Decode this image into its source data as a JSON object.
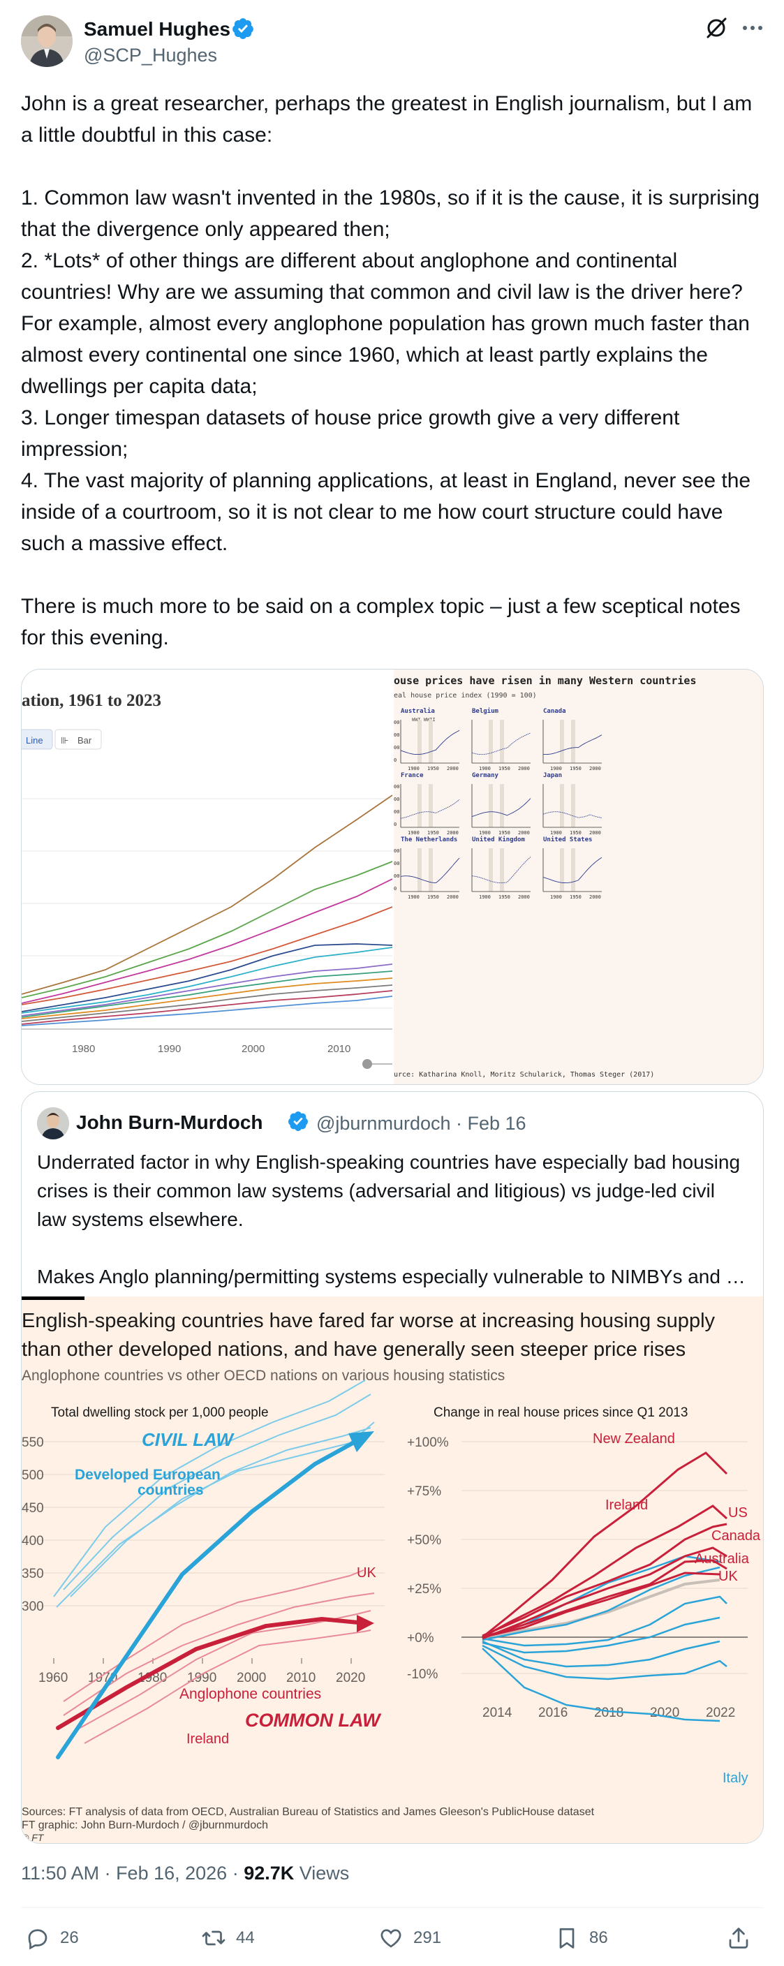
{
  "author": {
    "name": "Samuel Hughes",
    "handle": "@SCP_Hughes"
  },
  "tweet": {
    "paragraphs": [
      "John is a great researcher, perhaps the greatest in English journalism, but I am a little doubtful in this case:",
      "",
      "1. Common law wasn't invented in the 1980s, so if it is the cause, it is surprising that the divergence only appeared then;",
      "2. *Lots* of other things are different about anglophone and continental countries! Why are we assuming that common and civil law is the driver here? For example, almost every anglophone population has grown much faster than almost every continental one since 1960, which at least partly explains the dwellings per capita data;",
      "3. Longer timespan datasets of house price growth give a very different impression;",
      "4. The vast majority of planning applications, at least in England, never see the inside of a courtroom, so it is not clear to me how court structure could have such a massive effect.",
      "",
      "There is much more to be said on a complex topic – just a few sceptical notes for this evening."
    ]
  },
  "media_left": {
    "title_partial": "ation, 1961 to 2023",
    "toggle_line": "Line",
    "toggle_bar": "Bar",
    "x_ticks": [
      "1980",
      "1990",
      "2000",
      "2010"
    ]
  },
  "media_right": {
    "title": "ouse prices have risen in many Western countries",
    "subtitle": "eal house price index (1990 = 100)",
    "ww_label": "WWI WWII",
    "panels": [
      "Australia",
      "Belgium",
      "Canada",
      "France",
      "Germany",
      "Japan",
      "The Netherlands",
      "United Kingdom",
      "United States"
    ],
    "y_ticks": [
      "00",
      "00",
      "00",
      "0"
    ],
    "x_ticks": [
      "1900",
      "1950",
      "2000"
    ],
    "source": "urce: Katharina Knoll, Moritz Schularick, Thomas Steger (2017)"
  },
  "quote": {
    "name": "John Burn-Murdoch",
    "handle": "@jburnmurdoch · Feb 16",
    "text1": "Underrated factor in why English-speaking countries have especially bad housing crises is their common law systems (adversarial and litigious) vs judge-led civil law systems elsewhere.",
    "text2": "Makes Anglo planning/permitting systems especially vulnerable to NIMBYs and …"
  },
  "ft_graphic": {
    "title": "English-speaking countries have fared far worse at increasing housing supply than other developed nations, and have generally seen steeper price rises",
    "subtitle": "Anglophone countries vs other OECD nations on various housing statistics",
    "left_title": "Total dwelling stock per 1,000 people",
    "right_title": "Change in real house prices since Q1 2013",
    "left_y_ticks": [
      "550",
      "500",
      "450",
      "400",
      "350",
      "300"
    ],
    "left_x_ticks": [
      "1960",
      "1970",
      "1980",
      "1990",
      "2000",
      "2010",
      "2020"
    ],
    "right_y_ticks": [
      "+100%",
      "+75%",
      "+50%",
      "+25%",
      "+0%",
      "-10%"
    ],
    "right_x_ticks": [
      "2014",
      "2016",
      "2018",
      "2020",
      "2022"
    ],
    "label_civil_law": "CIVIL LAW",
    "label_developed_line1": "Developed European",
    "label_developed_line2": "countries",
    "label_uk_left": "UK",
    "label_anglophone": "Anglophone countries",
    "label_common_law": "COMMON LAW",
    "label_ireland_left": "Ireland",
    "label_nz": "New Zealand",
    "label_ireland_right": "Ireland",
    "label_us": "US",
    "label_canada": "Canada",
    "label_australia": "Australia",
    "label_uk_right": "UK",
    "label_italy": "Italy",
    "source_line1": "Sources: FT analysis of data from OECD, Australian Bureau of Statistics and James Gleeson's PublicHouse dataset",
    "source_line2": "FT graphic: John Burn-Murdoch / @jburnmurdoch",
    "ft_logo": "© FT"
  },
  "meta": {
    "time": "11:50 AM · Feb 16, 2026 · ",
    "views_count": "92.7K",
    "views_label": " Views"
  },
  "actions": {
    "replies": "26",
    "reposts": "44",
    "likes": "291",
    "bookmarks": "86"
  },
  "colors": {
    "verified_blue": "#1d9bf0",
    "civil_blue": "#2aa3d8",
    "common_red": "#c8203a",
    "ft_background": "#fff1e5"
  }
}
